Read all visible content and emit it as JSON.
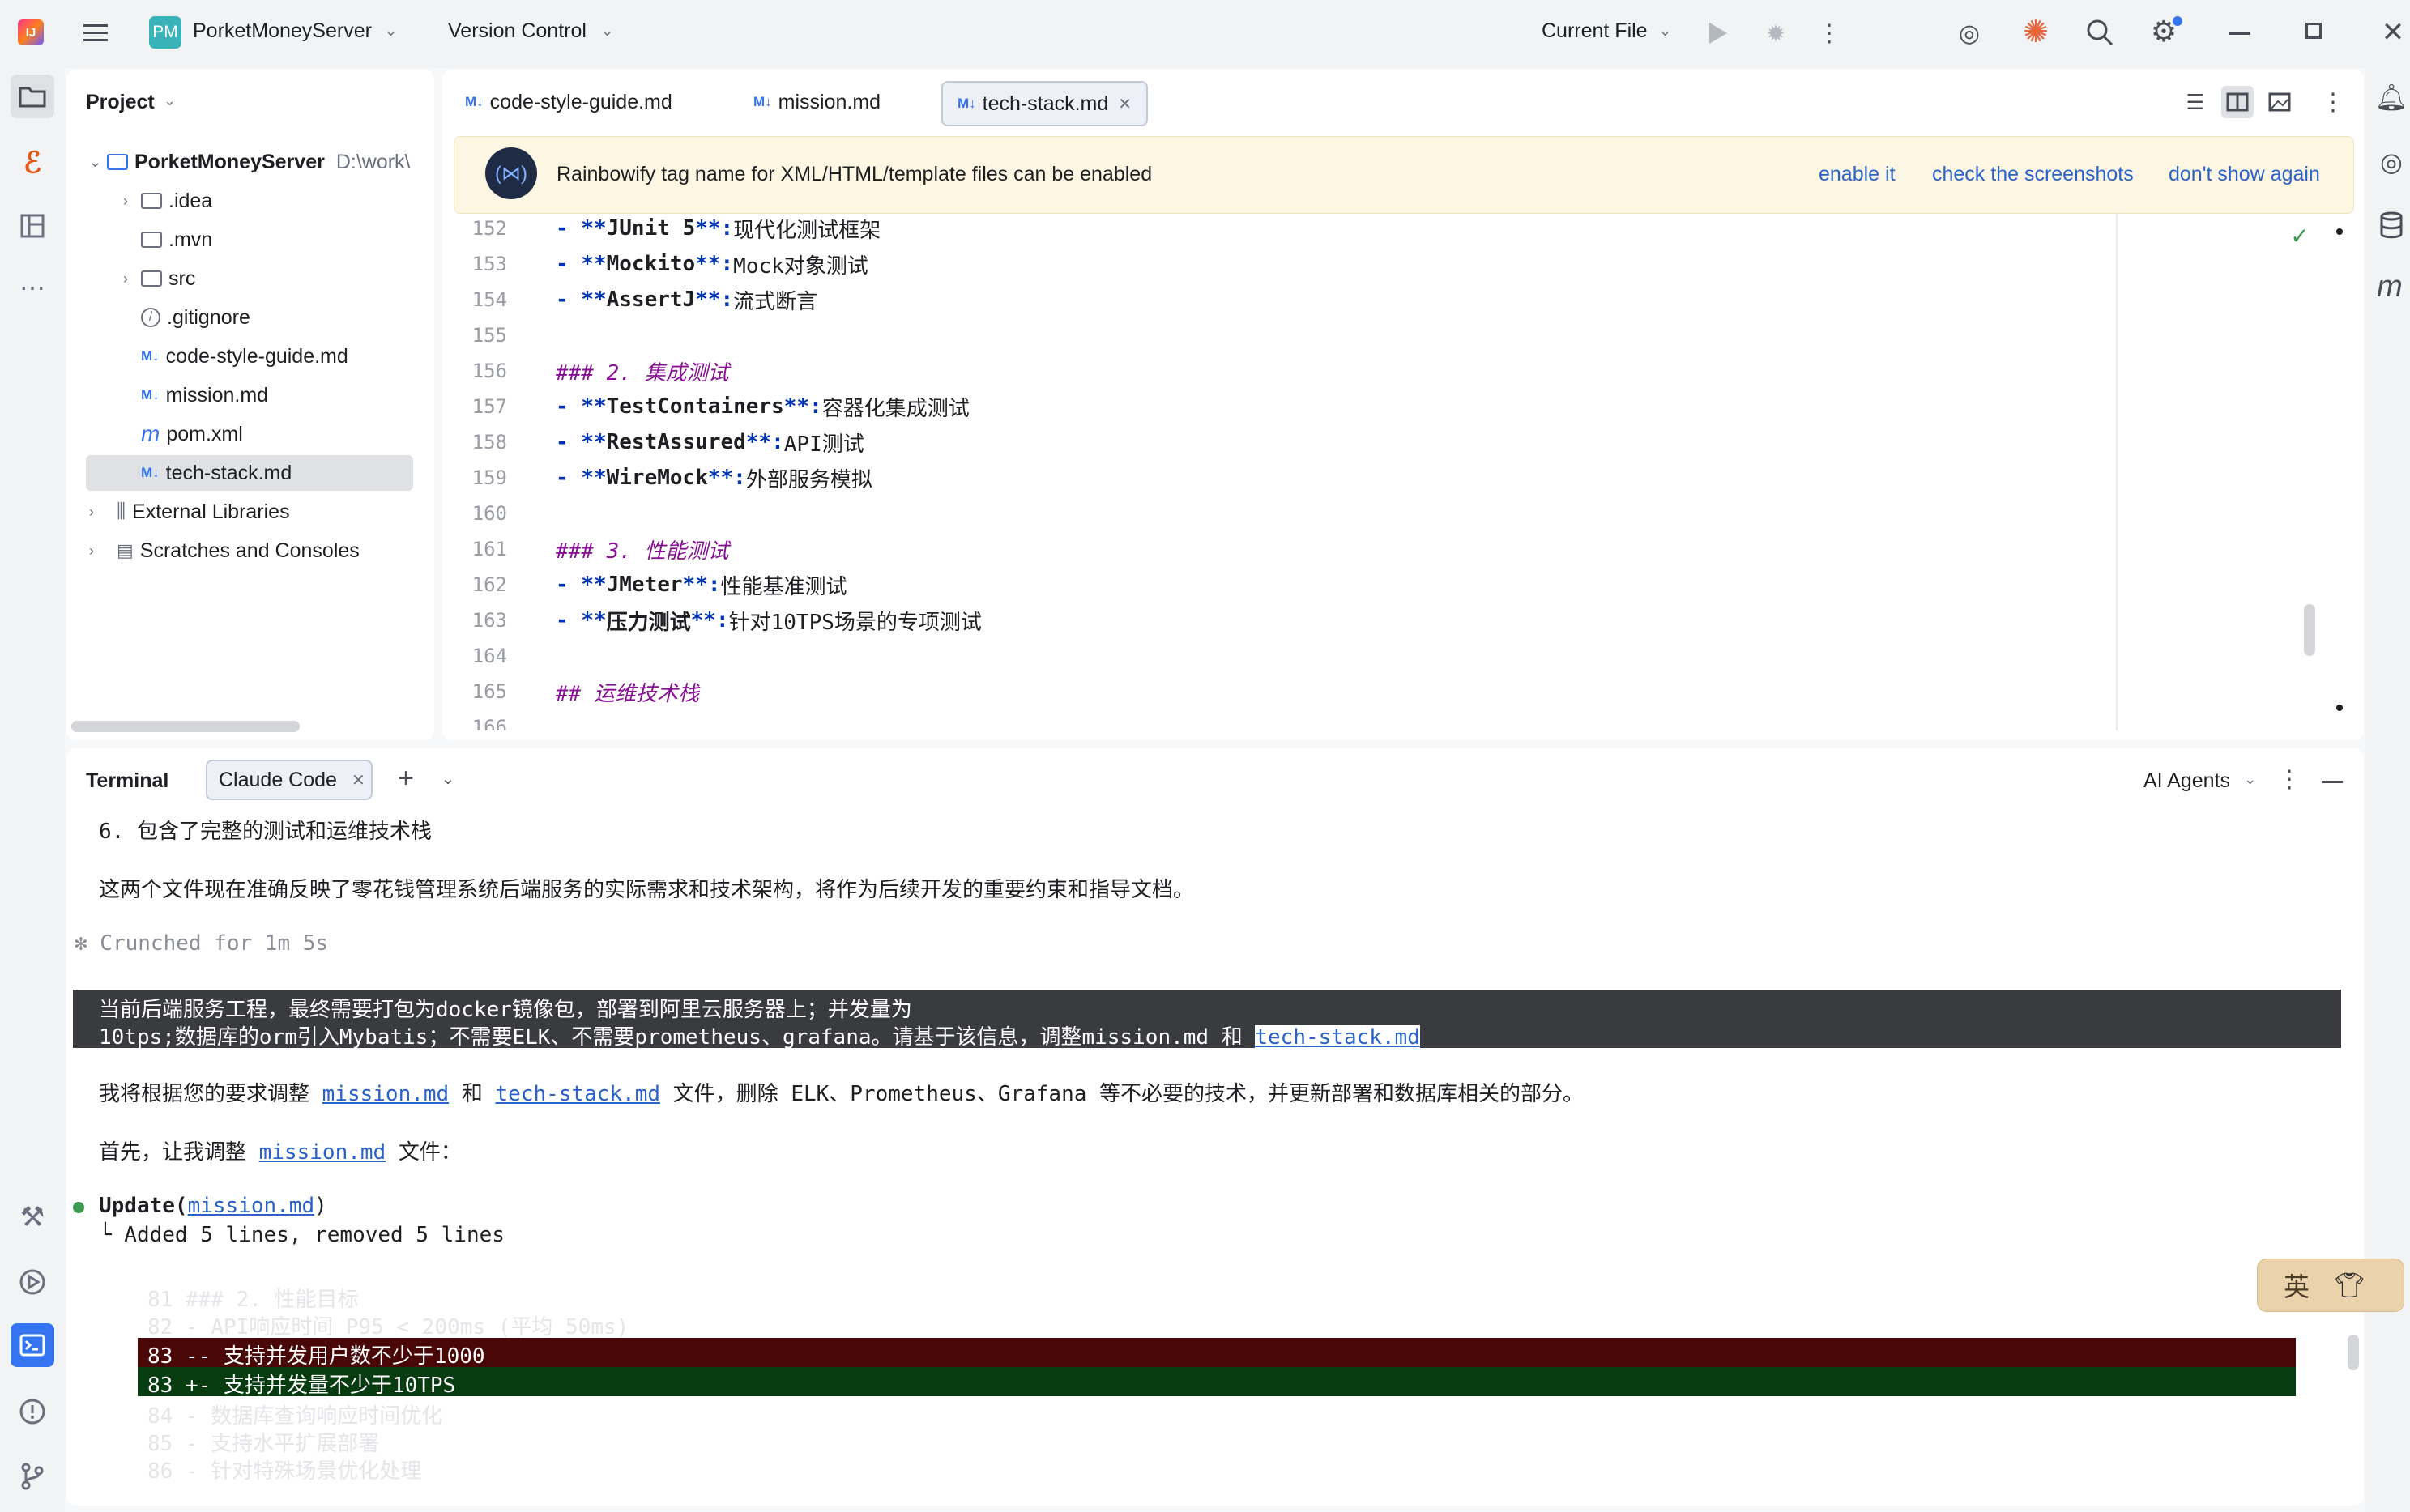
{
  "titlebar": {
    "project_badge": "PM",
    "project_name": "PorketMoneyServer",
    "version_control": "Version Control",
    "run_config": "Current File",
    "colors": {
      "badge": "#3ab3b8",
      "accent": "#3574f0"
    }
  },
  "project_panel": {
    "title": "Project",
    "root_name": "PorketMoneyServer",
    "root_path": "D:\\work\\",
    "items": [
      {
        "label": ".idea",
        "icon": "folder-icon"
      },
      {
        "label": ".mvn",
        "icon": "folder-icon"
      },
      {
        "label": "src",
        "icon": "folder-icon"
      },
      {
        "label": ".gitignore",
        "icon": "ignore-icon"
      },
      {
        "label": "code-style-guide.md",
        "icon": "markdown-icon"
      },
      {
        "label": "mission.md",
        "icon": "markdown-icon"
      },
      {
        "label": "pom.xml",
        "icon": "maven-icon"
      },
      {
        "label": "tech-stack.md",
        "icon": "markdown-icon"
      },
      {
        "label": "External Libraries",
        "icon": "library-icon"
      },
      {
        "label": "Scratches and Consoles",
        "icon": "scratch-icon"
      }
    ]
  },
  "editor": {
    "tabs": [
      "code-style-guide.md",
      "mission.md",
      "tech-stack.md"
    ],
    "active_tab": "tech-stack.md",
    "banner": {
      "text": "Rainbowify tag name for XML/HTML/template files can be enabled",
      "enable": "enable it",
      "screenshots": "check the screenshots",
      "dismiss": "don't show again"
    },
    "lines": [
      {
        "n": "152",
        "mark": "- **",
        "bold": "JUnit 5",
        "close": "**:",
        "text": " 现代化测试框架"
      },
      {
        "n": "153",
        "mark": "- **",
        "bold": "Mockito",
        "close": "**:",
        "text": " Mock对象测试"
      },
      {
        "n": "154",
        "mark": "- **",
        "bold": "AssertJ",
        "close": "**:",
        "text": " 流式断言"
      },
      {
        "n": "155",
        "mark": "",
        "bold": "",
        "close": "",
        "text": ""
      },
      {
        "n": "156",
        "head": "### 2. 集成测试"
      },
      {
        "n": "157",
        "mark": "- **",
        "bold": "TestContainers",
        "close": "**:",
        "text": " 容器化集成测试"
      },
      {
        "n": "158",
        "mark": "- **",
        "bold": "RestAssured",
        "close": "**:",
        "text": " API测试"
      },
      {
        "n": "159",
        "mark": "- **",
        "bold": "WireMock",
        "close": "**:",
        "text": " 外部服务模拟"
      },
      {
        "n": "160",
        "mark": "",
        "bold": "",
        "close": "",
        "text": ""
      },
      {
        "n": "161",
        "head": "### 3. 性能测试"
      },
      {
        "n": "162",
        "mark": "- **",
        "bold": "JMeter",
        "close": "**:",
        "text": " 性能基准测试"
      },
      {
        "n": "163",
        "mark": "- **",
        "bold": "压力测试",
        "close": "**:",
        "text": " 针对10TPS场景的专项测试"
      },
      {
        "n": "164",
        "mark": "",
        "bold": "",
        "close": "",
        "text": ""
      },
      {
        "n": "165",
        "head": "## 运维技术栈"
      },
      {
        "n": "166",
        "mark": "",
        "bold": "",
        "close": "",
        "text": ""
      }
    ]
  },
  "terminal": {
    "title": "Terminal",
    "tab": "Claude Code",
    "agents": "AI Agents",
    "l1": "6. 包含了完整的测试和运维技术栈",
    "l2": "这两个文件现在准确反映了零花钱管理系统后端服务的实际需求和技术架构，将作为后续开发的重要约束和指导文档。",
    "crunched": "✻ Crunched for 1m 5s",
    "prompt1": "当前后端服务工程，最终需要打包为docker镜像包，部署到阿里云服务器上；并发量为",
    "prompt2a": "10tps;数据库的orm引入Mybatis；不需要ELK、不需要prometheus、grafana。请基于该信息，调整mission.md 和 ",
    "prompt2b": "tech-stack.md",
    "reply_a": "我将根据您的要求调整 ",
    "reply_link1": "mission.md",
    "reply_b": " 和 ",
    "reply_link2": "tech-stack.md",
    "reply_c": " 文件，删除 ELK、Prometheus、Grafana 等不必要的技术，并更新部署和数据库相关的部分。",
    "first_a": "首先，让我调整 ",
    "first_link": "mission.md",
    "first_b": " 文件：",
    "update_label": "Update(",
    "update_link": "mission.md",
    "update_close": ")",
    "update_result": "└  Added 5 lines, removed 5 lines",
    "faded1": "81    ### 2. 性能目标",
    "faded2": "82    - API响应时间 P95 < 200ms (平均 50ms)",
    "diff_removed": "83 -- 支持并发用户数不少于1000",
    "diff_added": "83 +- 支持并发量不少于10TPS",
    "faded3": "84    - 数据库查询响应时间优化",
    "faded4": "85    - 支持水平扩展部署",
    "faded5": "86    - 针对特殊场景优化处理",
    "ime_char": "英"
  }
}
